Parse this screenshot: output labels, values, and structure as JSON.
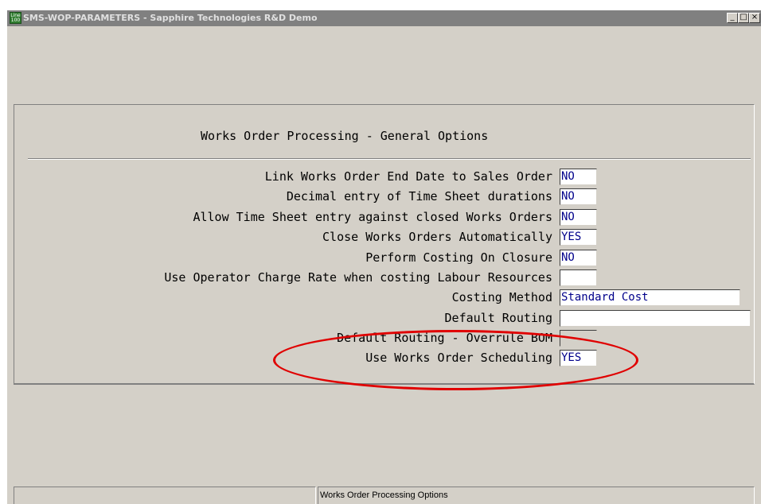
{
  "window": {
    "title": "SMS-WOP-PARAMETERS - Sapphire Technologies R&D Demo",
    "icon_text_top": "Line",
    "icon_text_bottom": "100",
    "controls": [
      "minimize-icon",
      "maximize-icon",
      "close-icon"
    ]
  },
  "form": {
    "title": "Works Order Processing - General Options",
    "rows": [
      {
        "label": "Link Works Order End Date to Sales Order",
        "value": "NO"
      },
      {
        "label": "Decimal entry of Time Sheet durations",
        "value": "NO"
      },
      {
        "label": "Allow Time Sheet entry against closed Works Orders",
        "value": "NO"
      },
      {
        "label": "Close Works Orders Automatically",
        "value": "YES"
      },
      {
        "label": "Perform Costing On Closure",
        "value": "NO"
      },
      {
        "label": "Use Operator Charge Rate when costing Labour Resources",
        "value": ""
      },
      {
        "label": "Costing Method",
        "value": "Standard Cost"
      },
      {
        "label": "Default Routing",
        "value": ""
      },
      {
        "label": "Default Routing - Overrule BOM",
        "value": ""
      },
      {
        "label": "Use Works Order Scheduling",
        "value": "YES"
      }
    ]
  },
  "annotation": {
    "color": "#e00000",
    "target": "Use Works Order Scheduling"
  },
  "statusbar": {
    "cells": [
      "",
      "Works Order Processing Options"
    ]
  }
}
